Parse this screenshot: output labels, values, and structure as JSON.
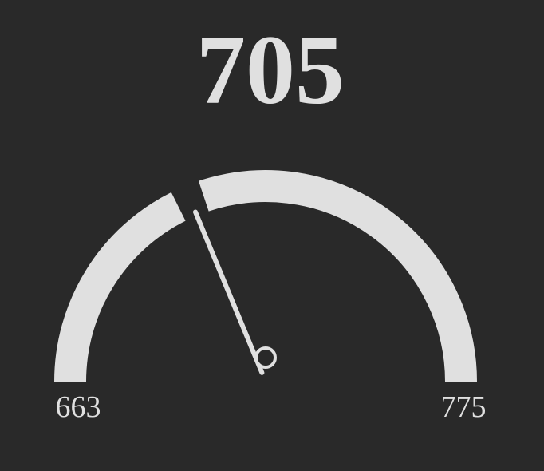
{
  "chart_data": {
    "type": "gauge",
    "value": 705,
    "min": 663,
    "max": 775,
    "value_label": "705",
    "min_label": "663",
    "max_label": "775"
  },
  "colors": {
    "background": "#292929",
    "arc": "#e0e0e0",
    "needle": "#e0e0e0",
    "text": "#e0e0e0"
  }
}
